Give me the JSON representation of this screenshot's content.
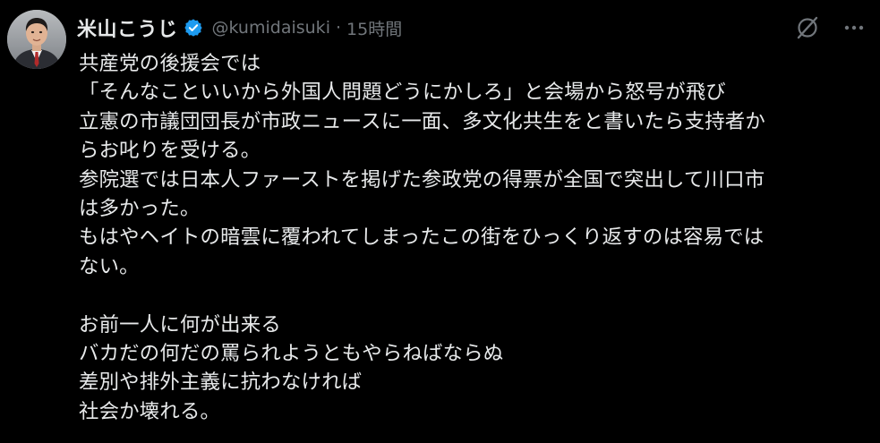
{
  "post": {
    "author": {
      "display_name": "米山こうじ",
      "handle": "@kumidaisuki",
      "verified": true,
      "avatar_icon": "profile-photo"
    },
    "separator": "·",
    "timestamp": "15時間",
    "actions": [
      {
        "name": "grok-icon",
        "icon": "slashed-circle"
      },
      {
        "name": "more-icon",
        "icon": "three-dots"
      }
    ],
    "lines": [
      "共産党の後援会では",
      "「そんなこといいから外国人問題どうにかしろ」と会場から怒号が飛び",
      "立憲の市議団団長が市政ニュースに一面、多文化共生をと書いたら支持者か",
      "らお叱りを受ける。",
      "参院選では日本人ファーストを掲げた参政党の得票が全国で突出して川口市",
      "は多かった。",
      "もはやヘイトの暗雲に覆われてしまったこの街をひっくり返すのは容易では",
      "ない。",
      "",
      "お前一人に何が出来る",
      "バカだの何だの罵られようともやらねばならぬ",
      "差別や排外主義に抗わなければ",
      "社会か壊れる。"
    ]
  },
  "colors": {
    "background": "#000000",
    "text": "#e7e9ea",
    "muted": "#71767b",
    "verified": "#1d9bf0"
  }
}
